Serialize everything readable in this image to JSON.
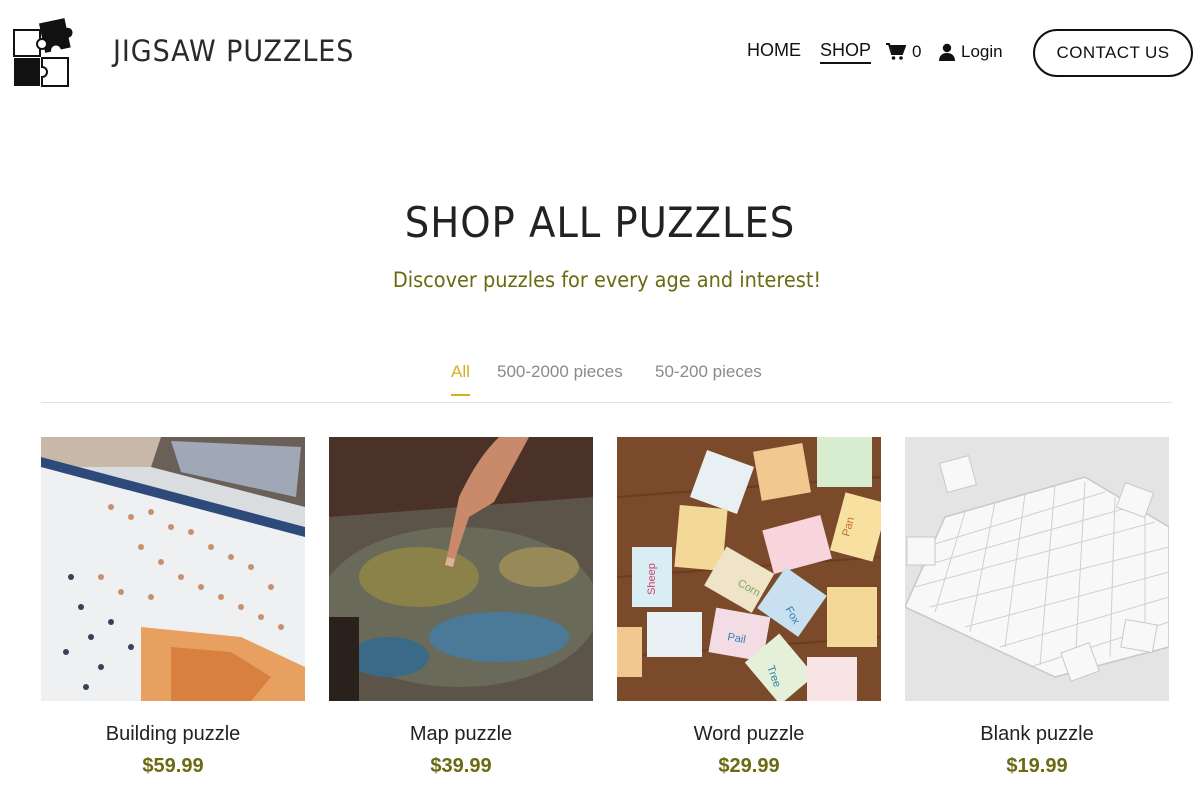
{
  "header": {
    "brand": "JIGSAW PUZZLES",
    "logo_icon": "puzzle-pieces-logo",
    "nav": {
      "home": "HOME",
      "shop": "SHOP",
      "cart_count": "0",
      "login": "Login",
      "contact": "CONTACT US"
    }
  },
  "hero": {
    "title": "SHOP ALL PUZZLES",
    "subtitle": "Discover puzzles for every age and interest!"
  },
  "filters": {
    "all": "All",
    "large": "500-2000 pieces",
    "small": "50-200 pieces",
    "active": "All"
  },
  "products": [
    {
      "name": "Building puzzle",
      "price": "$59.99"
    },
    {
      "name": "Map puzzle",
      "price": "$39.99"
    },
    {
      "name": "Word puzzle",
      "price": "$29.99"
    },
    {
      "name": "Blank puzzle",
      "price": "$19.99"
    }
  ],
  "colors": {
    "accent": "#d4b21b",
    "price": "#6b6a12",
    "text": "#222222"
  }
}
